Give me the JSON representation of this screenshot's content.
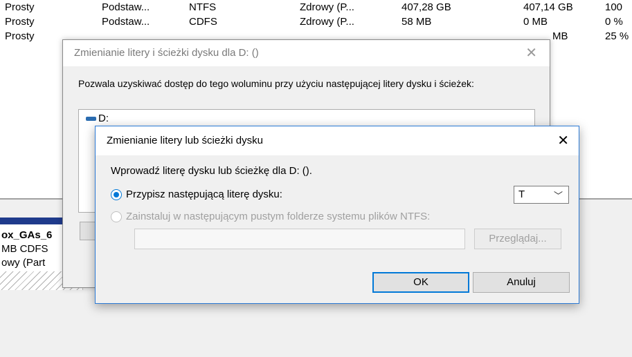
{
  "volume_list": {
    "rows": [
      [
        "Prosty",
        "Podstaw...",
        "NTFS",
        "Zdrowy (P...",
        "407,28 GB",
        "407,14 GB",
        "100"
      ],
      [
        "Prosty",
        "Podstaw...",
        "CDFS",
        "Zdrowy (P...",
        "58 MB",
        "0 MB",
        "0 %"
      ],
      [
        "Prosty",
        "",
        "",
        "",
        "",
        "MB",
        "25 %"
      ]
    ]
  },
  "disk_map": {
    "volume_name": "ox_GAs_6",
    "volume_size": "MB CDFS",
    "volume_status": "owy (Part"
  },
  "outer_dialog": {
    "title": "Zmienianie litery i ścieżki dysku dla D: ()",
    "description": "Pozwala uzyskiwać dostęp do tego woluminu przy użyciu następującej litery dysku i ścieżek:",
    "list_items": [
      "D:"
    ],
    "close_glyph": "✕"
  },
  "inner_dialog": {
    "title": "Zmienianie litery lub ścieżki dysku",
    "close_glyph": "✕",
    "prompt": "Wprowadź literę dysku lub ścieżkę dla D: ().",
    "option_letter_label": "Przypisz następującą literę dysku:",
    "option_letter_selected": true,
    "drive_letter_value": "T",
    "combo_arrow": "﹀",
    "option_folder_label": "Zainstaluj w następującym pustym folderze systemu plików NTFS:",
    "option_folder_selected": false,
    "folder_path_value": "",
    "browse_label": "Przeglądaj...",
    "ok_label": "OK",
    "cancel_label": "Anuluj"
  },
  "colors": {
    "accent": "#0078d7",
    "volume_bar": "#1f3b8c"
  }
}
